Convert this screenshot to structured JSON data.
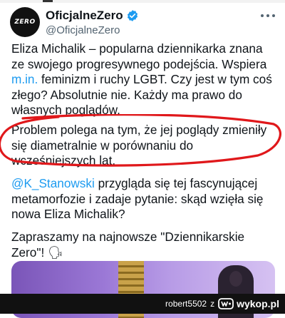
{
  "header": {
    "avatar_text": "ZERO",
    "display_name": "OficjalneZero",
    "handle": "@OficjalneZero"
  },
  "tweet": {
    "p1": "Eliza Michalik – popularna dziennikarka znana ze swojego progresywnego podejścia. Wspiera ",
    "p1_link": "m.in.",
    "p1_rest": " feminizm i ruchy LGBT. Czy jest w tym coś złego? Absolutnie nie. Każdy ma prawo do własnych poglądów.",
    "p2": "Problem polega na tym, że jej poglądy zmieniły się diametralnie w porównaniu do wcześniejszych lat.",
    "p3_mention": "@K_Stanowski",
    "p3_rest": " przygląda się tej fascynującej metamorfozie i zadaje pytanie: skąd wzięła się nowa Eliza Michalik?",
    "p4": "Zapraszamy na najnowsze \"Dziennikarskie Zero\"! 🗣"
  },
  "footer": {
    "author": "robert5502",
    "separator": "z",
    "site": "wykop.pl"
  },
  "colors": {
    "link": "#1d9bf0",
    "highlight": "#e0181b",
    "verified": "#1d9bf0"
  },
  "icons": [
    "verified-badge-icon",
    "more-options-icon",
    "speaking-head-emoji",
    "wykop-logo-icon"
  ]
}
